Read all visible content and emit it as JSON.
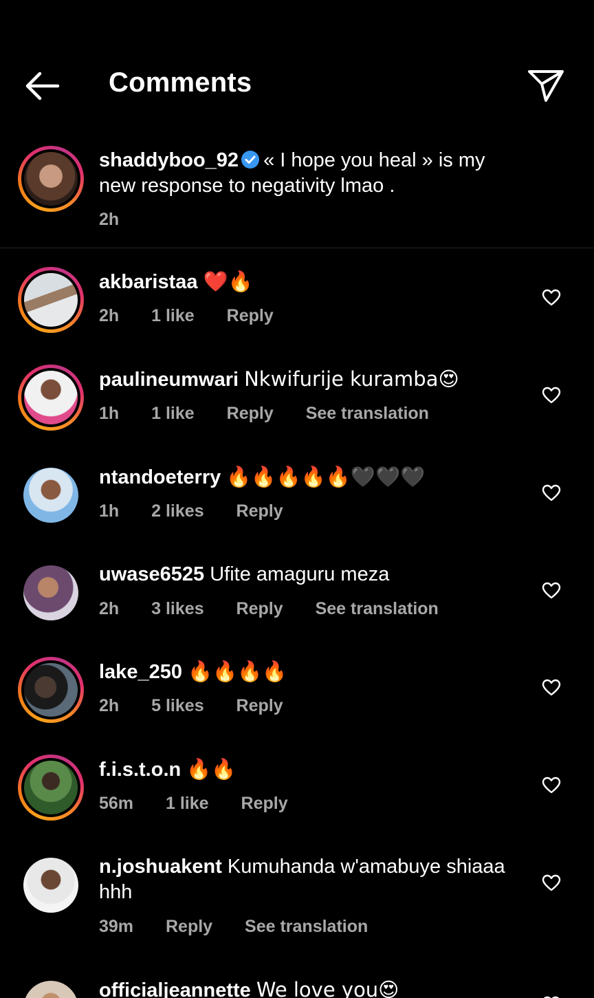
{
  "header": {
    "title": "Comments",
    "back_icon": "arrow-left-icon",
    "share_icon": "paper-plane-icon"
  },
  "caption": {
    "username": "shaddyboo_92",
    "verified": true,
    "text": "« I hope you heal » is my new response to negativity lmao .",
    "time": "2h"
  },
  "comments": [
    {
      "username": "akbaristaa",
      "text": "❤️🔥",
      "time": "2h",
      "likes": "1 like",
      "reply": "Reply",
      "translate": ""
    },
    {
      "username": "paulineumwari",
      "text": "Nkwifurije kuramba😍",
      "time": "1h",
      "likes": "1 like",
      "reply": "Reply",
      "translate": "See translation"
    },
    {
      "username": "ntandoeterry",
      "text": "🔥🔥🔥🔥🔥🖤🖤🖤",
      "time": "1h",
      "likes": "2 likes",
      "reply": "Reply",
      "translate": ""
    },
    {
      "username": "uwase6525",
      "text": "Ufite amaguru meza",
      "time": "2h",
      "likes": "3 likes",
      "reply": "Reply",
      "translate": "See translation"
    },
    {
      "username": "lake_250",
      "text": "🔥🔥🔥🔥",
      "time": "2h",
      "likes": "5 likes",
      "reply": "Reply",
      "translate": ""
    },
    {
      "username": "f.i.s.t.o.n",
      "text": "🔥🔥",
      "time": "56m",
      "likes": "1 like",
      "reply": "Reply",
      "translate": ""
    },
    {
      "username": "n.joshuakent",
      "text": "Kumuhanda w'amabuye shiaaa hhh",
      "time": "39m",
      "likes": "",
      "reply": "Reply",
      "translate": "See translation"
    },
    {
      "username": "officialjeannette",
      "text": "We love you😍",
      "time": "",
      "likes": "",
      "reply": "",
      "translate": ""
    }
  ],
  "colors": {
    "background": "#000000",
    "meta_text": "#a8a8a8",
    "verified_blue": "#3897f0"
  }
}
